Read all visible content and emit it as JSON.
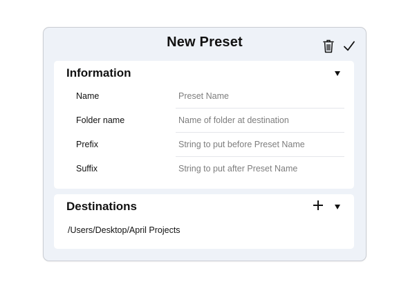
{
  "dialog": {
    "title": "New Preset",
    "actions": {
      "delete_icon": "trash-icon",
      "confirm_icon": "checkmark-icon"
    }
  },
  "information": {
    "title": "Information",
    "toggle_icon": "triangle-down-icon",
    "fields": [
      {
        "label": "Name",
        "value": "",
        "placeholder": "Preset Name"
      },
      {
        "label": "Folder name",
        "value": "",
        "placeholder": "Name of folder at destination"
      },
      {
        "label": "Prefix",
        "value": "",
        "placeholder": "String to put before Preset Name"
      },
      {
        "label": "Suffix",
        "value": "",
        "placeholder": "String to put after Preset Name"
      }
    ]
  },
  "destinations": {
    "title": "Destinations",
    "add_icon": "plus-icon",
    "toggle_icon": "triangle-down-icon",
    "items": [
      "/Users/Desktop/April Projects"
    ]
  },
  "colors": {
    "dialog_background": "#eef2f8",
    "card_background": "#ffffff",
    "placeholder_text": "#7d7d7d"
  }
}
